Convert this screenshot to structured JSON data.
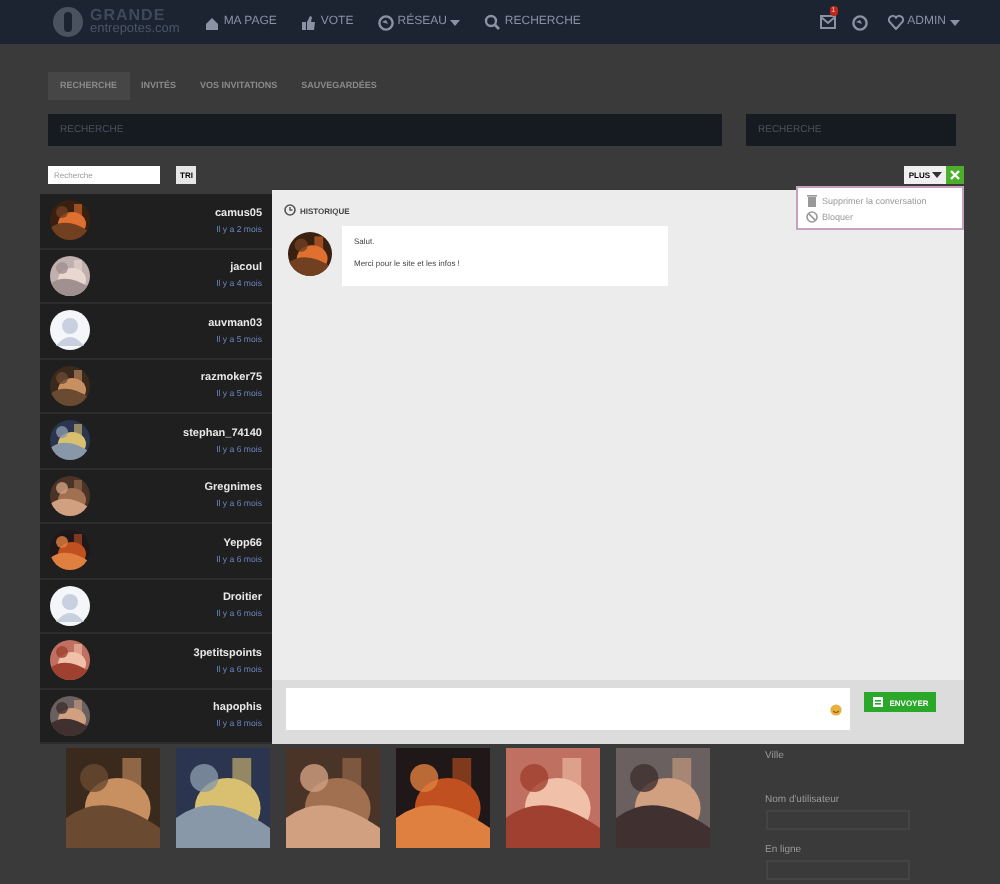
{
  "navbar": {
    "logo_top": "GRANDE",
    "logo_bottom": "entrepotes.com",
    "items": [
      {
        "label": "MA PAGE",
        "dropdown": false
      },
      {
        "label": "VOTE",
        "dropdown": false
      },
      {
        "label": "RÉSEAU",
        "dropdown": true
      },
      {
        "label": "RECHERCHE",
        "dropdown": false
      }
    ],
    "mail_badge": "1",
    "user": "ADMIN"
  },
  "page": {
    "tabs": [
      {
        "label": "RECHERCHE",
        "selected": true
      },
      {
        "label": "INVITÉS",
        "selected": false
      },
      {
        "label": "VOS INVITATIONS",
        "selected": false
      },
      {
        "label": "SAUVEGARDÉES",
        "selected": false
      }
    ],
    "main_heading": "RECHERCHE",
    "side_heading": "RECHERCHE",
    "side_labels": [
      "Ville",
      "Nom d'utilisateur",
      "En ligne"
    ],
    "gallery": [
      {
        "kind": "picture"
      },
      {
        "kind": "picture"
      },
      {
        "kind": "picture"
      },
      {
        "kind": "picture"
      },
      {
        "kind": "picture"
      },
      {
        "kind": "picture"
      }
    ]
  },
  "messenger": {
    "search": {
      "placeholder": "Recherche"
    },
    "sort_button": "TRI",
    "more_button": "PLUS",
    "menu": [
      {
        "label": "Supprimer la conversation"
      },
      {
        "label": "Bloquer"
      }
    ],
    "conversations": [
      {
        "name": "camus05",
        "time": "Il y a 2 mois",
        "kind": "picture",
        "selected": false
      },
      {
        "name": "jacoul",
        "time": "Il y a 4 mois",
        "kind": "picture",
        "selected": false
      },
      {
        "name": "auvman03",
        "time": "Il y a 5 mois",
        "kind": "silhouette",
        "selected": false
      },
      {
        "name": "razmoker75",
        "time": "Il y a 5 mois",
        "kind": "picture",
        "selected": false
      },
      {
        "name": "stephan_74140",
        "time": "Il y a 6 mois",
        "kind": "picture",
        "selected": false
      },
      {
        "name": "Gregnimes",
        "time": "Il y a 6 mois",
        "kind": "picture",
        "selected": false
      },
      {
        "name": "Yepp66",
        "time": "Il y a 6 mois",
        "kind": "picture",
        "selected": false
      },
      {
        "name": "Droitier",
        "time": "Il y a 6 mois",
        "kind": "silhouette",
        "selected": false
      },
      {
        "name": "3petitspoints",
        "time": "Il y a 6 mois",
        "kind": "picture",
        "selected": false
      },
      {
        "name": "hapophis",
        "time": "Il y a 8 mois",
        "kind": "picture",
        "selected": false
      }
    ],
    "history_label": "HISTORIQUE",
    "messages": [
      {
        "lines": [
          "Salut.",
          "Merci pour le site et les infos !"
        ]
      }
    ],
    "send_button": "ENVOYER"
  }
}
